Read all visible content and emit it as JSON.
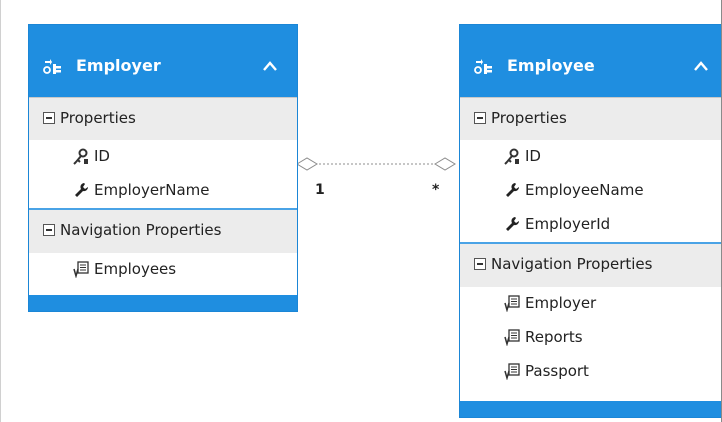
{
  "entities": [
    {
      "title": "Employer",
      "properties_label": "Properties",
      "properties": [
        {
          "name": "ID",
          "icon": "key-icon"
        },
        {
          "name": "EmployerName",
          "icon": "wrench-icon"
        }
      ],
      "navigation_label": "Navigation Properties",
      "navigation": [
        {
          "name": "Employees",
          "icon": "navigation-property-icon"
        }
      ]
    },
    {
      "title": "Employee",
      "properties_label": "Properties",
      "properties": [
        {
          "name": "ID",
          "icon": "key-icon"
        },
        {
          "name": "EmployeeName",
          "icon": "wrench-icon"
        },
        {
          "name": "EmployerId",
          "icon": "wrench-icon"
        }
      ],
      "navigation_label": "Navigation Properties",
      "navigation": [
        {
          "name": "Employer",
          "icon": "navigation-property-icon"
        },
        {
          "name": "Reports",
          "icon": "navigation-property-icon"
        },
        {
          "name": "Passport",
          "icon": "navigation-property-icon"
        }
      ]
    }
  ],
  "association": {
    "left_multiplicity": "1",
    "right_multiplicity": "*"
  },
  "colors": {
    "header_blue": "#1f8ee0",
    "section_gray": "#ececec"
  }
}
